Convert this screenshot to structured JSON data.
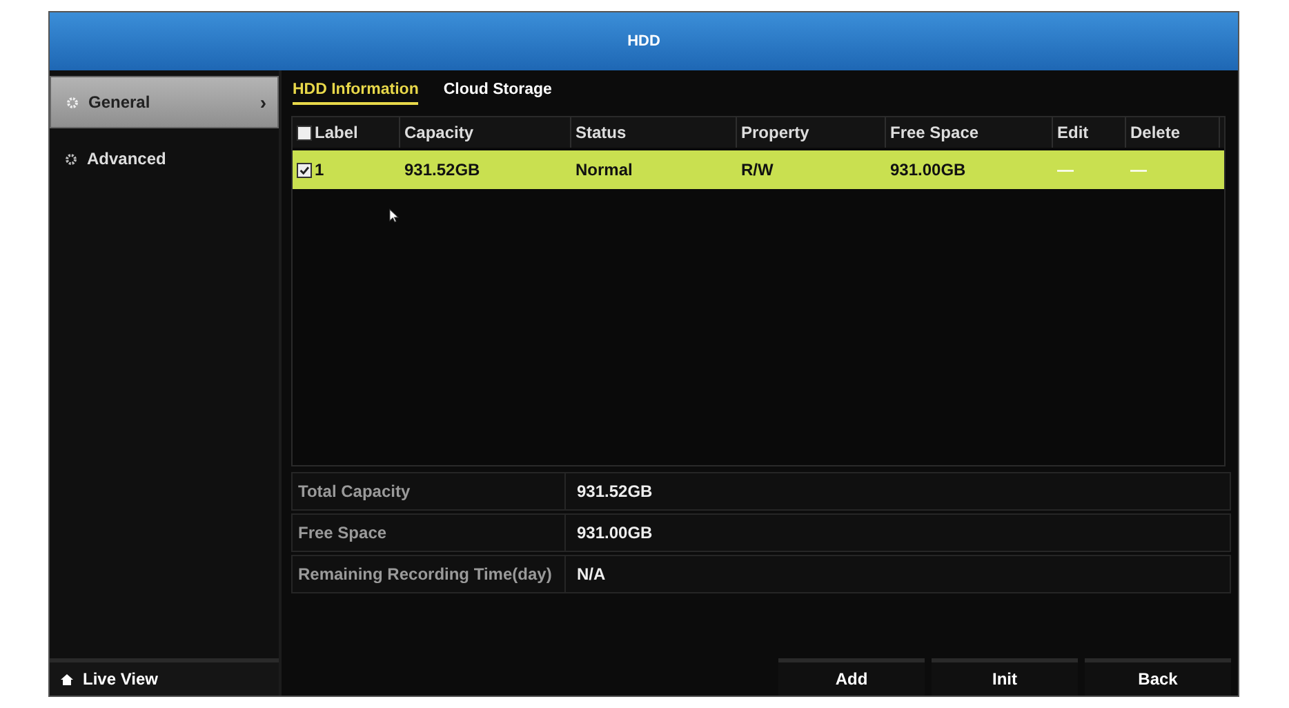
{
  "window": {
    "title": "HDD"
  },
  "sidebar": {
    "items": [
      {
        "label": "General",
        "selected": true,
        "chevron": "›"
      },
      {
        "label": "Advanced",
        "selected": false
      }
    ],
    "footer": "Live View"
  },
  "tabs": [
    {
      "label": "HDD Information",
      "selected": true
    },
    {
      "label": "Cloud Storage",
      "selected": false
    }
  ],
  "table": {
    "columns": [
      "Label",
      "Capacity",
      "Status",
      "Property",
      "Free Space",
      "Edit",
      "Delete"
    ],
    "header_checked": false,
    "rows": [
      {
        "checked": true,
        "selected": true,
        "cells": [
          "1",
          "931.52GB",
          "Normal",
          "R/W",
          "931.00GB",
          "—",
          "—"
        ]
      }
    ]
  },
  "summary": [
    {
      "label": "Total Capacity",
      "value": "931.52GB"
    },
    {
      "label": "Free Space",
      "value": "931.00GB"
    },
    {
      "label": "Remaining Recording Time(day)",
      "value": "N/A"
    }
  ],
  "buttons": [
    "Add",
    "Init",
    "Back"
  ]
}
